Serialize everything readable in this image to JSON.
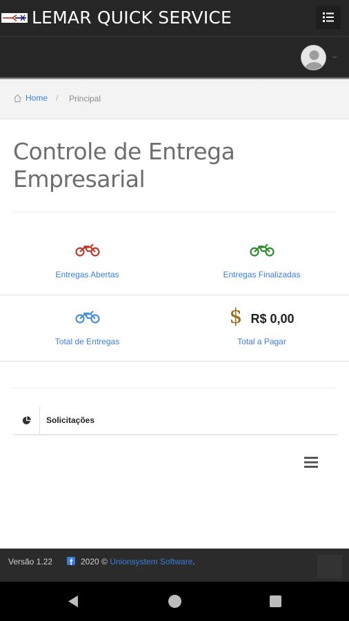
{
  "header": {
    "app_title": "LEMAR QUICK SERVICE",
    "logo_icon": "lemar-logo",
    "menu_icon": "list-menu-icon"
  },
  "user": {
    "avatar_icon": "user-avatar",
    "dropdown_icon": "chevron-down-icon"
  },
  "breadcrumb": {
    "home_label": "Home",
    "separator": "/",
    "current_label": "Principal"
  },
  "page": {
    "title": "Controle de Entrega Empresarial"
  },
  "stats": [
    {
      "label": "Entregas Abertas",
      "icon": "motorcycle-icon",
      "color": "#c0392b"
    },
    {
      "label": "Entregas Finalizadas",
      "icon": "motorcycle-icon",
      "color": "#2e8b2e"
    },
    {
      "label": "Total de Entregas",
      "icon": "motorcycle-icon",
      "color": "#4a90d9"
    },
    {
      "label": "Total a Pagar",
      "icon": "dollar-icon",
      "currency_symbol": "$",
      "value": "R$ 0,00",
      "color": "#9b6b14"
    }
  ],
  "panel": {
    "title": "Solicitações",
    "icon": "pie-chart-icon",
    "menu_icon": "hamburger-icon"
  },
  "footer": {
    "version": "Versão 1.22",
    "copyright": "2020 ©",
    "company_link": "Unionsystem Software",
    "trailing": "."
  },
  "colors": {
    "header_bg": "#262626",
    "link": "#3b7ddb",
    "footer_bg": "#2b2b2b"
  }
}
